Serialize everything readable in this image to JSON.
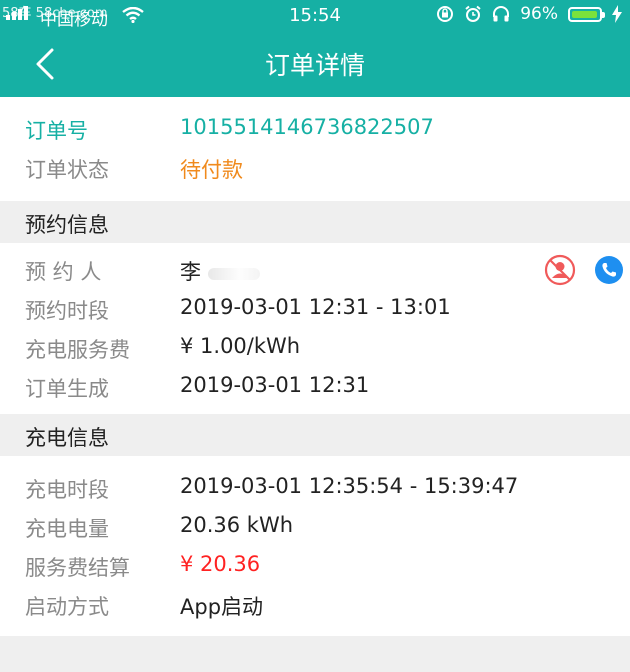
{
  "status_bar": {
    "watermark": "58车 58che.com",
    "carrier": "中国移动",
    "time": "15:54",
    "battery": "96%",
    "battery_level": 0.96,
    "colors": {
      "bar": "#16b0a4",
      "battery_fill": "#7be23c"
    }
  },
  "nav": {
    "title": "订单详情",
    "back_icon": "chevron-left-icon"
  },
  "order": {
    "number_label": "订单号",
    "number_value": "1015514146736822507",
    "status_label": "订单状态",
    "status_value": "待付款"
  },
  "reservation": {
    "section_title": "预约信息",
    "person_label": "预 约 人",
    "person_value": "李",
    "period_label": "预约时段",
    "period_value": "2019-03-01 12:31 - 13:01",
    "fee_label": "充电服务费",
    "fee_value": "¥ 1.00/kWh",
    "created_label": "订单生成",
    "created_value": "2019-03-01 12:31",
    "icons": [
      "user-blocked-icon",
      "phone-icon"
    ]
  },
  "charging": {
    "section_title": "充电信息",
    "period_label": "充电时段",
    "period_value": "2019-03-01 12:35:54 - 15:39:47",
    "energy_label": "充电电量",
    "energy_value": "20.36 kWh",
    "settle_label": "服务费结算",
    "settle_value": "¥ 20.36",
    "start_label": "启动方式",
    "start_value": "App启动"
  },
  "colors": {
    "accent": "#16b0a4",
    "pending": "#f08a1c",
    "amount": "#ff2222",
    "blocked_icon": "#f05a5a",
    "phone_icon": "#1e8ff0"
  }
}
